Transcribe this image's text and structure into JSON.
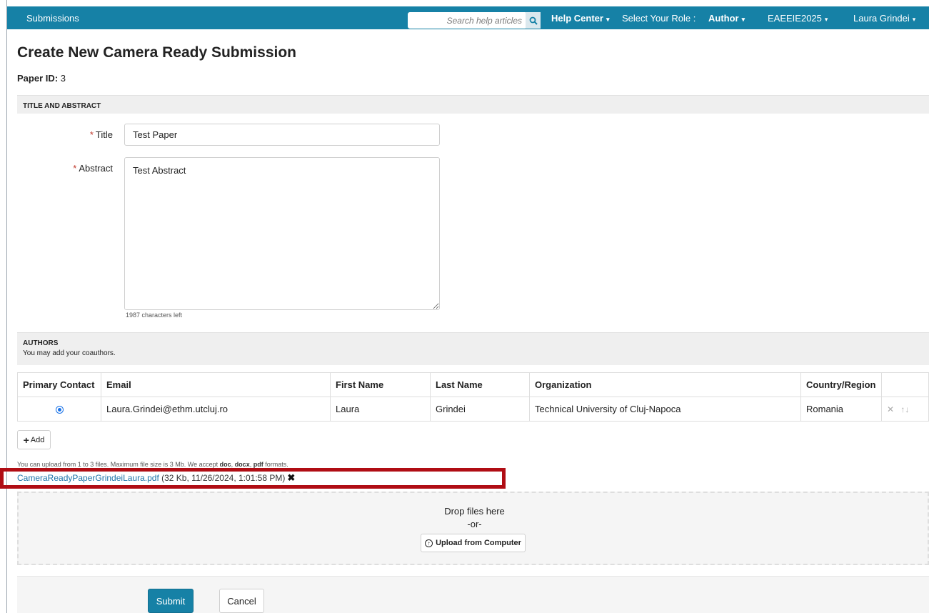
{
  "topbar": {
    "brand": "Submissions",
    "search_placeholder": "Search help articles",
    "help_center": "Help Center",
    "select_role_label": "Select Your Role :",
    "role": "Author",
    "conference": "EAEEIE2025",
    "user": "Laura Grindei",
    "accent_color": "#1681a6"
  },
  "page": {
    "title": "Create New Camera Ready Submission",
    "paper_id_label": "Paper ID:",
    "paper_id_value": "3"
  },
  "title_abstract": {
    "heading": "TITLE AND ABSTRACT",
    "title_label": "Title",
    "title_value": "Test Paper",
    "abstract_label": "Abstract",
    "abstract_value": "Test Abstract",
    "chars_left": "1987 characters left",
    "required_mark": "*"
  },
  "authors": {
    "heading": "AUTHORS",
    "subheading": "You may add your coauthors.",
    "columns": [
      "Primary Contact",
      "Email",
      "First Name",
      "Last Name",
      "Organization",
      "Country/Region"
    ],
    "rows": [
      {
        "primary": true,
        "email": "Laura.Grindei@ethm.utcluj.ro",
        "first_name": "Laura",
        "last_name": "Grindei",
        "organization": "Technical University of Cluj-Napoca",
        "country": "Romania"
      }
    ],
    "add_label": "Add",
    "row_action_icons": [
      "close-icon",
      "arrow-up-icon",
      "arrow-down-icon"
    ]
  },
  "files": {
    "note_prefix": "You can upload from 1 to 3 files. Maximum file size is 3 Mb. We accept",
    "format_1": "doc",
    "format_2": "docx",
    "format_3": "pdf",
    "note_suffix": "formats.",
    "file_name": "CameraReadyPaperGrindeiLaura.pdf",
    "file_meta": "(32 Kb, 11/26/2024, 1:01:58 PM)",
    "drop_text": "Drop files here",
    "or_text": "-or-",
    "upload_label": "Upload from Computer",
    "highlight_color": "#b00d14"
  },
  "actions": {
    "submit_label": "Submit",
    "cancel_label": "Cancel"
  }
}
